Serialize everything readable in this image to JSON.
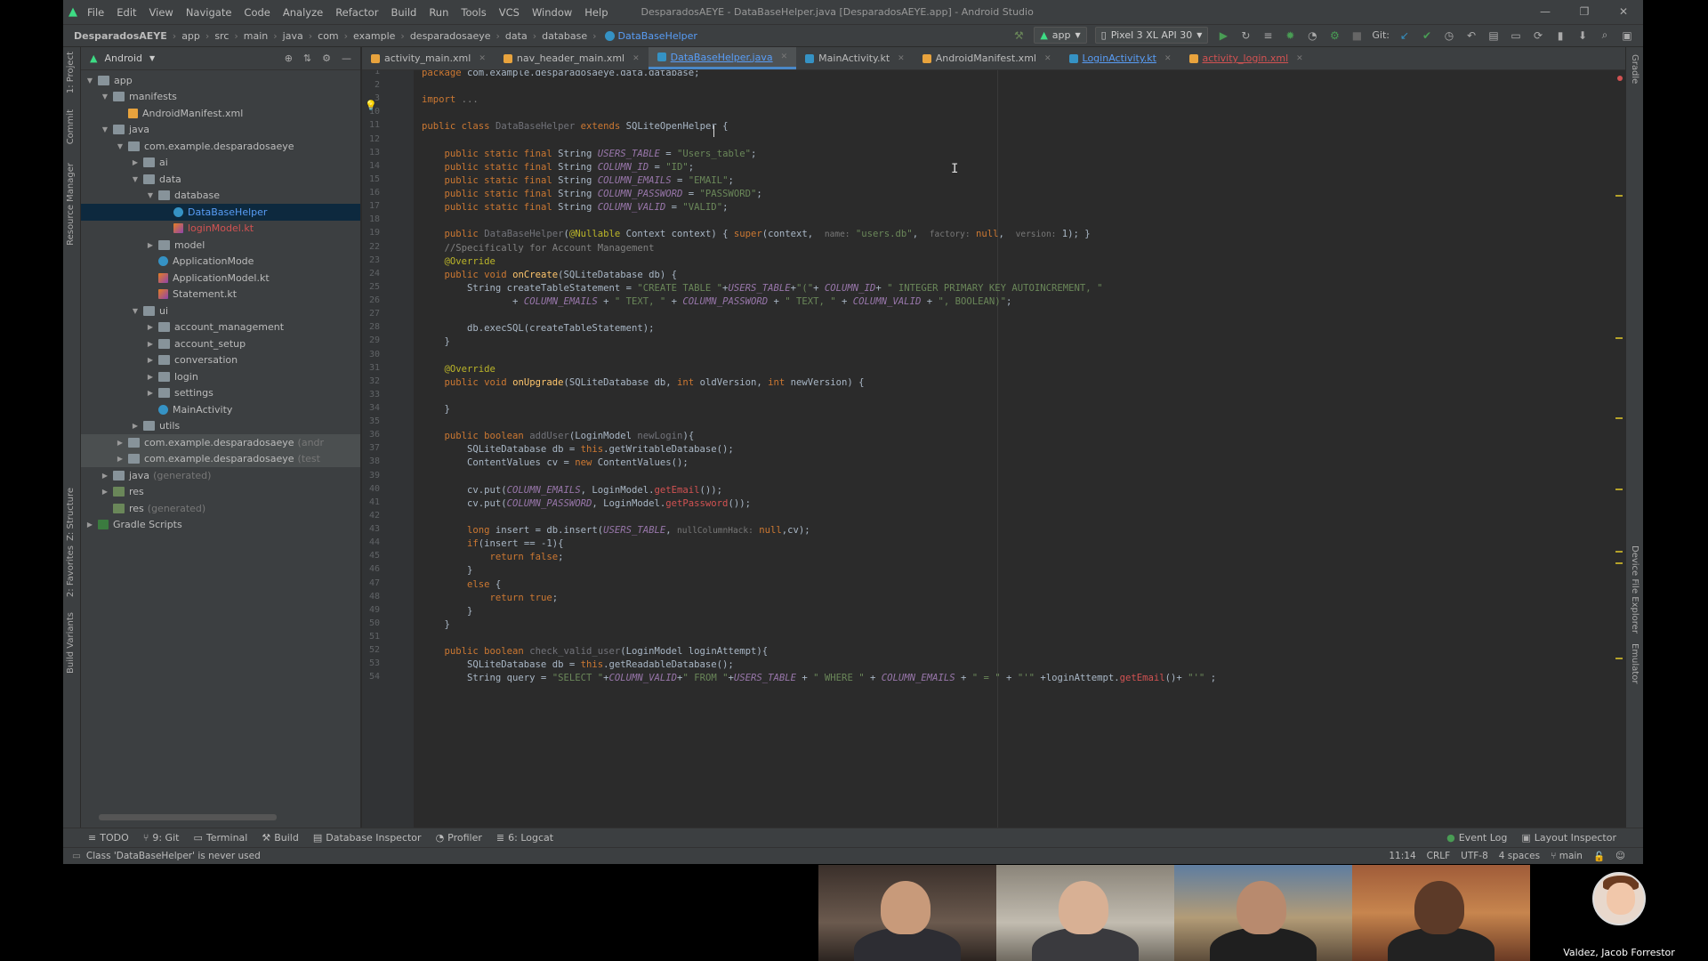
{
  "menu": [
    "File",
    "Edit",
    "View",
    "Navigate",
    "Code",
    "Analyze",
    "Refactor",
    "Build",
    "Run",
    "Tools",
    "VCS",
    "Window",
    "Help"
  ],
  "window_title": "DesparadosAEYE - DataBaseHelper.java [DesparadosAEYE.app] - Android Studio",
  "window_controls": [
    "—",
    "❐",
    "✕"
  ],
  "breadcrumbs": [
    "DesparadosAEYE",
    "app",
    "src",
    "main",
    "java",
    "com",
    "example",
    "desparadosaeye",
    "data",
    "database",
    "DataBaseHelper"
  ],
  "run_config": "app",
  "device": "Pixel 3 XL API 30",
  "git_label": "Git:",
  "project_view": "Android",
  "tree": [
    {
      "label": "app",
      "depth": 0,
      "icon": "fold",
      "arrow": "▼"
    },
    {
      "label": "manifests",
      "depth": 1,
      "icon": "fold",
      "arrow": "▼"
    },
    {
      "label": "AndroidManifest.xml",
      "depth": 2,
      "icon": "xml",
      "arrow": ""
    },
    {
      "label": "java",
      "depth": 1,
      "icon": "fold",
      "arrow": "▼"
    },
    {
      "label": "com.example.desparadosaeye",
      "depth": 2,
      "icon": "pkg",
      "arrow": "▼"
    },
    {
      "label": "ai",
      "depth": 3,
      "icon": "pkg",
      "arrow": "▶"
    },
    {
      "label": "data",
      "depth": 3,
      "icon": "pkg",
      "arrow": "▼"
    },
    {
      "label": "database",
      "depth": 4,
      "icon": "pkg",
      "arrow": "▼"
    },
    {
      "label": "DataBaseHelper",
      "depth": 5,
      "icon": "cls",
      "arrow": "",
      "style": "blue",
      "sel": true
    },
    {
      "label": "loginModel.kt",
      "depth": 5,
      "icon": "kt",
      "arrow": "",
      "style": "red"
    },
    {
      "label": "model",
      "depth": 4,
      "icon": "pkg",
      "arrow": "▶"
    },
    {
      "label": "ApplicationMode",
      "depth": 4,
      "icon": "cls",
      "arrow": ""
    },
    {
      "label": "ApplicationModel.kt",
      "depth": 4,
      "icon": "kt",
      "arrow": ""
    },
    {
      "label": "Statement.kt",
      "depth": 4,
      "icon": "kt",
      "arrow": ""
    },
    {
      "label": "ui",
      "depth": 3,
      "icon": "pkg",
      "arrow": "▼"
    },
    {
      "label": "account_management",
      "depth": 4,
      "icon": "pkg",
      "arrow": "▶"
    },
    {
      "label": "account_setup",
      "depth": 4,
      "icon": "pkg",
      "arrow": "▶"
    },
    {
      "label": "conversation",
      "depth": 4,
      "icon": "pkg",
      "arrow": "▶"
    },
    {
      "label": "login",
      "depth": 4,
      "icon": "pkg",
      "arrow": "▶"
    },
    {
      "label": "settings",
      "depth": 4,
      "icon": "pkg",
      "arrow": "▶"
    },
    {
      "label": "MainActivity",
      "depth": 4,
      "icon": "cls",
      "arrow": ""
    },
    {
      "label": "utils",
      "depth": 3,
      "icon": "pkg",
      "arrow": "▶"
    },
    {
      "label": "com.example.desparadosaeye",
      "suffix": "(andr",
      "depth": 2,
      "icon": "pkg",
      "arrow": "▶",
      "grp": true
    },
    {
      "label": "com.example.desparadosaeye",
      "suffix": "(test",
      "depth": 2,
      "icon": "pkg",
      "arrow": "▶",
      "grp": true
    },
    {
      "label": "java",
      "suffix": "(generated)",
      "depth": 1,
      "icon": "fold",
      "arrow": "▶"
    },
    {
      "label": "res",
      "depth": 1,
      "icon": "res",
      "arrow": "▶"
    },
    {
      "label": "res",
      "suffix": "(generated)",
      "depth": 1,
      "icon": "res",
      "arrow": ""
    },
    {
      "label": "Gradle Scripts",
      "depth": 0,
      "icon": "gradle",
      "arrow": "▶"
    }
  ],
  "tabs": [
    {
      "label": "activity_main.xml",
      "icon": "#e8a33d"
    },
    {
      "label": "nav_header_main.xml",
      "icon": "#e8a33d"
    },
    {
      "label": "DataBaseHelper.java",
      "icon": "#3592c4",
      "active": true,
      "style": "blue"
    },
    {
      "label": "MainActivity.kt",
      "icon": "#3592c4"
    },
    {
      "label": "AndroidManifest.xml",
      "icon": "#e8a33d"
    },
    {
      "label": "LoginActivity.kt",
      "icon": "#3592c4",
      "style": "blue"
    },
    {
      "label": "activity_login.xml",
      "icon": "#e8a33d",
      "style": "red"
    }
  ],
  "code_lines": [
    {
      "n": "1",
      "html": "<span class=\"kw\">package</span> com.example.desparadosaeye.data.database;"
    },
    {
      "n": "2",
      "html": ""
    },
    {
      "n": "3",
      "html": "<span class=\"kw\">import</span> <span class=\"cm\">...</span>"
    },
    {
      "n": "10",
      "html": ""
    },
    {
      "n": "11",
      "html": "<span class=\"kw\">public class</span> <span class=\"unused\">DataBaseHelper</span> <span class=\"kw\">extends</span> SQLiteOpenHelper {"
    },
    {
      "n": "12",
      "html": ""
    },
    {
      "n": "13",
      "html": "    <span class=\"kw\">public static final</span> String <span class=\"st\">USERS_TABLE</span> = <span class=\"str\">\"Users_table\"</span>;"
    },
    {
      "n": "14",
      "html": "    <span class=\"kw\">public static final</span> String <span class=\"st\">COLUMN_ID</span> = <span class=\"str\">\"ID\"</span>;"
    },
    {
      "n": "15",
      "html": "    <span class=\"kw\">public static final</span> String <span class=\"st\">COLUMN_EMAILS</span> = <span class=\"str\">\"EMAIL\"</span>;"
    },
    {
      "n": "16",
      "html": "    <span class=\"kw\">public static final</span> String <span class=\"st\">COLUMN_PASSWORD</span> = <span class=\"str\">\"PASSWORD\"</span>;"
    },
    {
      "n": "17",
      "html": "    <span class=\"kw\">public static final</span> String <span class=\"st\">COLUMN_VALID</span> = <span class=\"str\">\"VALID\"</span>;"
    },
    {
      "n": "18",
      "html": ""
    },
    {
      "n": "19",
      "html": "    <span class=\"kw\">public</span> <span class=\"unused\">DataBaseHelper</span>(<span class=\"ann\">@Nullable</span> Context context) { <span class=\"kw\">super</span>(context,  <span class=\"hint\">name:</span> <span class=\"str\">\"users.db\"</span>,  <span class=\"hint\">factory:</span> <span class=\"kw\">null</span>,  <span class=\"hint\">version:</span> 1); }"
    },
    {
      "n": "22",
      "html": "    <span class=\"cm\">//Specifically for Account Management</span>"
    },
    {
      "n": "23",
      "html": "    <span class=\"ann\">@Override</span>"
    },
    {
      "n": "24",
      "html": "    <span class=\"kw\">public void</span> <span class=\"fn\">onCreate</span>(SQLiteDatabase db) {"
    },
    {
      "n": "25",
      "html": "        String createTableStatement = <span class=\"str\">\"CREATE TABLE \"</span>+<span class=\"st\">USERS_TABLE</span>+<span class=\"str\">\"(\"</span>+ <span class=\"st\">COLUMN_ID</span>+ <span class=\"str\">\" INTEGER PRIMARY KEY AUTOINCREMENT, \"</span>"
    },
    {
      "n": "26",
      "html": "                + <span class=\"st\">COLUMN_EMAILS</span> + <span class=\"str\">\" TEXT, \"</span> + <span class=\"st\">COLUMN_PASSWORD</span> + <span class=\"str\">\" TEXT, \"</span> + <span class=\"st\">COLUMN_VALID</span> + <span class=\"str\">\", BOOLEAN)\"</span>;"
    },
    {
      "n": "27",
      "html": ""
    },
    {
      "n": "28",
      "html": "        db.execSQL(createTableStatement);"
    },
    {
      "n": "29",
      "html": "    }"
    },
    {
      "n": "30",
      "html": ""
    },
    {
      "n": "31",
      "html": "    <span class=\"ann\">@Override</span>"
    },
    {
      "n": "32",
      "html": "    <span class=\"kw\">public void</span> <span class=\"fn\">onUpgrade</span>(SQLiteDatabase db, <span class=\"kw\">int</span> oldVersion, <span class=\"kw\">int</span> newVersion) {"
    },
    {
      "n": "33",
      "html": ""
    },
    {
      "n": "34",
      "html": "    }"
    },
    {
      "n": "35",
      "html": ""
    },
    {
      "n": "36",
      "html": "    <span class=\"kw\">public boolean</span> <span class=\"unused\">addUser</span>(LoginModel <span class=\"unused\">newLogin</span>){"
    },
    {
      "n": "37",
      "html": "        SQLiteDatabase db = <span class=\"kw\">this</span>.getWritableDatabase();"
    },
    {
      "n": "38",
      "html": "        ContentValues cv = <span class=\"kw\">new</span> ContentValues();"
    },
    {
      "n": "39",
      "html": ""
    },
    {
      "n": "40",
      "html": "        cv.put(<span class=\"st\">COLUMN_EMAILS</span>, LoginModel.<span class=\"red\">getEmail</span>());"
    },
    {
      "n": "41",
      "html": "        cv.put(<span class=\"st\">COLUMN_PASSWORD</span>, LoginModel.<span class=\"red\">getPassword</span>());"
    },
    {
      "n": "42",
      "html": ""
    },
    {
      "n": "43",
      "html": "        <span class=\"kw\">long</span> insert = db.insert(<span class=\"st\">USERS_TABLE</span>, <span class=\"hint\">nullColumnHack:</span> <span class=\"kw\">null</span>,cv);"
    },
    {
      "n": "44",
      "html": "        <span class=\"kw\">if</span>(insert == -1){"
    },
    {
      "n": "45",
      "html": "            <span class=\"kw\">return false</span>;"
    },
    {
      "n": "46",
      "html": "        }"
    },
    {
      "n": "47",
      "html": "        <span class=\"kw\">else</span> {"
    },
    {
      "n": "48",
      "html": "            <span class=\"kw\">return true</span>;"
    },
    {
      "n": "49",
      "html": "        }"
    },
    {
      "n": "50",
      "html": "    }"
    },
    {
      "n": "51",
      "html": ""
    },
    {
      "n": "52",
      "html": "    <span class=\"kw\">public boolean</span> <span class=\"unused\">check_valid_user</span>(LoginModel loginAttempt){"
    },
    {
      "n": "53",
      "html": "        SQLiteDatabase db = <span class=\"kw\">this</span>.getReadableDatabase();"
    },
    {
      "n": "54",
      "html": "        String query = <span class=\"str\">\"SELECT \"</span>+<span class=\"st\">COLUMN_VALID</span>+<span class=\"str\">\" FROM \"</span>+<span class=\"st\">USERS_TABLE</span> + <span class=\"str\">\" WHERE \"</span> + <span class=\"st\">COLUMN_EMAILS</span> + <span class=\"str\">\" = \"</span> + <span class=\"str\">\"'\"</span> +loginAttempt.<span class=\"red\">getEmail</span>()+ <span class=\"str\">\"'\"</span> ;"
    }
  ],
  "left_strip": [
    "1: Project",
    "Commit",
    "Resource Manager",
    "Z: Structure",
    "2: Favorites",
    "Build Variants"
  ],
  "right_strip": [
    "Gradle",
    "Device File Explorer",
    "Emulator"
  ],
  "bottom_tools": [
    "TODO",
    "9: Git",
    "Terminal",
    "Build",
    "Database Inspector",
    "Profiler",
    "6: Logcat"
  ],
  "bottom_right_tools": [
    "Event Log",
    "Layout Inspector"
  ],
  "status": {
    "message": "Class 'DataBaseHelper' is never used",
    "position": "11:14",
    "line_sep": "CRLF",
    "encoding": "UTF-8",
    "indent": "4 spaces",
    "branch": "main"
  },
  "participant_name": "Valdez, Jacob Forrestor",
  "colors": {
    "accent": "#4a88c7",
    "keyword": "#cc7832",
    "string": "#6a8759",
    "static": "#9876aa"
  }
}
